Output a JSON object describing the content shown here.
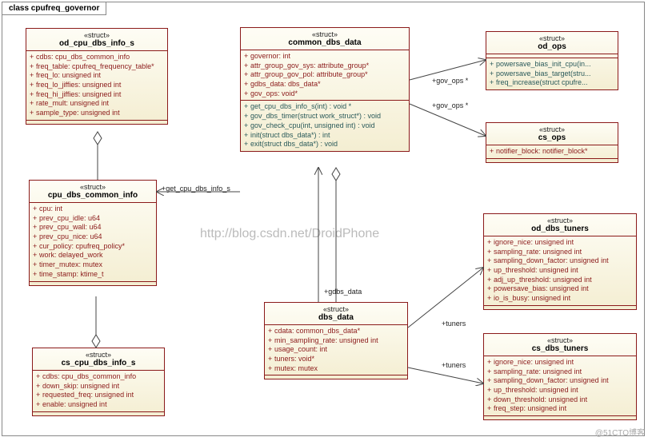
{
  "frame_title": "class cpufreq_governor",
  "watermark": "http://blog.csdn.net/DroidPhone",
  "corner_mark": "@51CTO博客",
  "classes": {
    "od_cpu_dbs_info_s": {
      "stereotype": "«struct»",
      "name": "od_cpu_dbs_info_s",
      "attrs": [
        "cdbs: cpu_dbs_common_info",
        "freq_table: cpufreq_frequency_table*",
        "freq_lo: unsigned int",
        "freq_lo_jiffies: unsigned int",
        "freq_hi_jiffies: unsigned int",
        "rate_mult: unsigned int",
        "sample_type: unsigned int"
      ]
    },
    "cpu_dbs_common_info": {
      "stereotype": "«struct»",
      "name": "cpu_dbs_common_info",
      "attrs": [
        "cpu: int",
        "prev_cpu_idle: u64",
        "prev_cpu_wall: u64",
        "prev_cpu_nice: u64",
        "cur_policy: cpufreq_policy*",
        "work: delayed_work",
        "timer_mutex: mutex",
        "time_stamp: ktime_t"
      ]
    },
    "cs_cpu_dbs_info_s": {
      "stereotype": "«struct»",
      "name": "cs_cpu_dbs_info_s",
      "attrs": [
        "cdbs: cpu_dbs_common_info",
        "down_skip: unsigned int",
        "requested_freq: unsigned int",
        "enable: unsigned int"
      ]
    },
    "common_dbs_data": {
      "stereotype": "«struct»",
      "name": "common_dbs_data",
      "attrs": [
        "governor: int",
        "attr_group_gov_sys: attribute_group*",
        "attr_group_gov_pol: attribute_group*",
        "gdbs_data: dbs_data*",
        "gov_ops: void*"
      ],
      "methods": [
        "get_cpu_dbs_info_s(int) : void *",
        "gov_dbs_timer(struct work_struct*) : void",
        "gov_check_cpu(int, unsigned int) : void",
        "init(struct dbs_data*) : int",
        "exit(struct dbs_data*) : void"
      ]
    },
    "dbs_data": {
      "stereotype": "«struct»",
      "name": "dbs_data",
      "attrs": [
        "cdata: common_dbs_data*",
        "min_sampling_rate: unsigned int",
        "usage_count: int",
        "tuners: void*",
        "mutex: mutex"
      ]
    },
    "od_ops": {
      "stereotype": "«struct»",
      "name": "od_ops",
      "attrs": [
        "powersave_bias_init_cpu(in...",
        "powersave_bias_target(stru...",
        "freq_increase(struct cpufre..."
      ]
    },
    "cs_ops": {
      "stereotype": "«struct»",
      "name": "cs_ops",
      "attrs": [
        "notifier_block: notifier_block*"
      ]
    },
    "od_dbs_tuners": {
      "stereotype": "«struct»",
      "name": "od_dbs_tuners",
      "attrs": [
        "ignore_nice: unsigned int",
        "sampling_rate: unsigned int",
        "sampling_down_factor: unsigned int",
        "up_threshold: unsigned int",
        "adj_up_threshold: unsigned int",
        "powersave_bias: unsigned int",
        "io_is_busy: unsigned int"
      ]
    },
    "cs_dbs_tuners": {
      "stereotype": "«struct»",
      "name": "cs_dbs_tuners",
      "attrs": [
        "ignore_nice: unsigned int",
        "sampling_rate: unsigned int",
        "sampling_down_factor: unsigned int",
        "up_threshold: unsigned int",
        "down_threshold: unsigned int",
        "freq_step: unsigned int"
      ]
    }
  },
  "edge_labels": {
    "get_cpu_dbs_info_s": "+get_cpu_dbs_info_s",
    "gov_ops1": "+gov_ops *",
    "gov_ops2": "+gov_ops *",
    "gdbs_data": "+gdbs_data",
    "tuners1": "+tuners",
    "tuners2": "+tuners"
  }
}
